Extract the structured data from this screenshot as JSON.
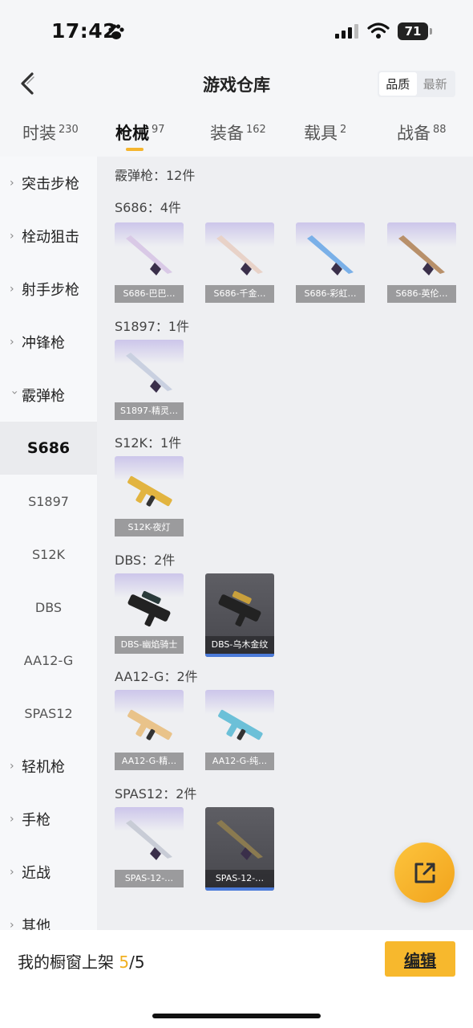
{
  "status_bar": {
    "time": "17:42",
    "battery": "71"
  },
  "header": {
    "title": "游戏仓库",
    "sort_options": [
      "品质",
      "最新"
    ]
  },
  "tabs": [
    {
      "label": "时装",
      "count": "230"
    },
    {
      "label": "枪械",
      "count": "97"
    },
    {
      "label": "装备",
      "count": "162"
    },
    {
      "label": "载具",
      "count": "2"
    },
    {
      "label": "战备",
      "count": "88"
    }
  ],
  "sidebar": {
    "categories": [
      "突击步枪",
      "栓动狙击",
      "射手步枪",
      "冲锋枪",
      "霰弹枪"
    ],
    "subcategories": [
      "S686",
      "S1897",
      "S12K",
      "DBS",
      "AA12-G",
      "SPAS12"
    ],
    "more_categories": [
      "轻机枪",
      "手枪",
      "近战",
      "其他"
    ]
  },
  "content": {
    "summary": "霰弹枪：12件",
    "groups": [
      {
        "title": "S686：4件",
        "items": [
          {
            "name": "S686-巴巴…",
            "rarity": "purple"
          },
          {
            "name": "S686-千金…",
            "rarity": "purple"
          },
          {
            "name": "S686-彩虹…",
            "rarity": "purple"
          },
          {
            "name": "S686-英伦…",
            "rarity": "purple"
          }
        ]
      },
      {
        "title": "S1897：1件",
        "items": [
          {
            "name": "S1897-精灵…",
            "rarity": "purple"
          }
        ]
      },
      {
        "title": "S12K：1件",
        "items": [
          {
            "name": "S12K-夜灯",
            "rarity": "purple"
          }
        ]
      },
      {
        "title": "DBS：2件",
        "items": [
          {
            "name": "DBS-幽焰骑士",
            "rarity": "purple"
          },
          {
            "name": "DBS-乌木金纹",
            "rarity": "gray"
          }
        ]
      },
      {
        "title": "AA12-G：2件",
        "items": [
          {
            "name": "AA12-G-精…",
            "rarity": "purple"
          },
          {
            "name": "AA12-G-纯…",
            "rarity": "purple"
          }
        ]
      },
      {
        "title": "SPAS12：2件",
        "items": [
          {
            "name": "SPAS-12-…",
            "rarity": "purple"
          },
          {
            "name": "SPAS-12-…",
            "rarity": "gray"
          }
        ]
      }
    ]
  },
  "bottom_bar": {
    "shelf_label": "我的橱窗上架",
    "shelf_current": "5",
    "shelf_total": "/5",
    "edit_label": "编辑"
  },
  "fab": {
    "icon": "share-icon"
  },
  "colors": {
    "accent": "#f7b82d",
    "rarity_purple": "#2b2566",
    "rarity_gray": "#4d4d53"
  }
}
